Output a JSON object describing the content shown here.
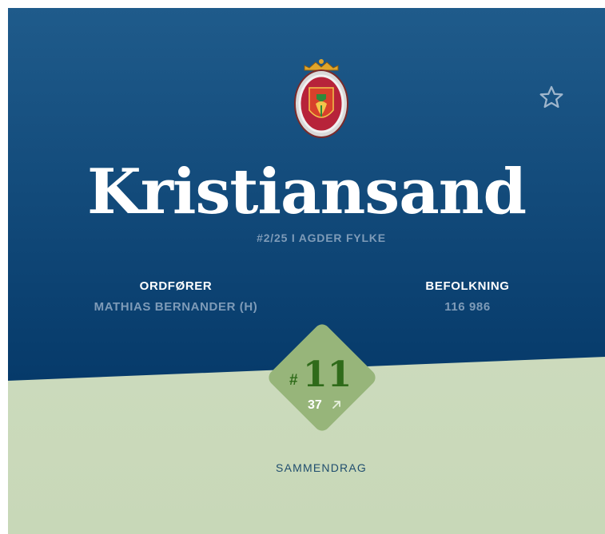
{
  "header": {
    "municipality_name": "Kristiansand",
    "rank_in_county": "#2/25 I AGDER FYLKE",
    "crest_icon": "coat-of-arms-icon",
    "favorite_icon": "star-outline-icon"
  },
  "stats": {
    "mayor_label": "ORDFØRER",
    "mayor_value": "MATHIAS BERNANDER (H)",
    "population_label": "BEFOLKNING",
    "population_value": "116 986"
  },
  "ranking": {
    "hash": "#",
    "rank": "11",
    "count": "37",
    "trend_icon": "arrow-up-right-icon"
  },
  "footer": {
    "summary_link": "SAMMENDRAG"
  },
  "colors": {
    "header_top": "#1f5b8b",
    "header_bottom": "#063a6a",
    "lower_bg": "#cfdcc0",
    "diamond": "#97b57a",
    "rank_text": "#2f6b1a",
    "muted_text": "#7e9bb8"
  }
}
